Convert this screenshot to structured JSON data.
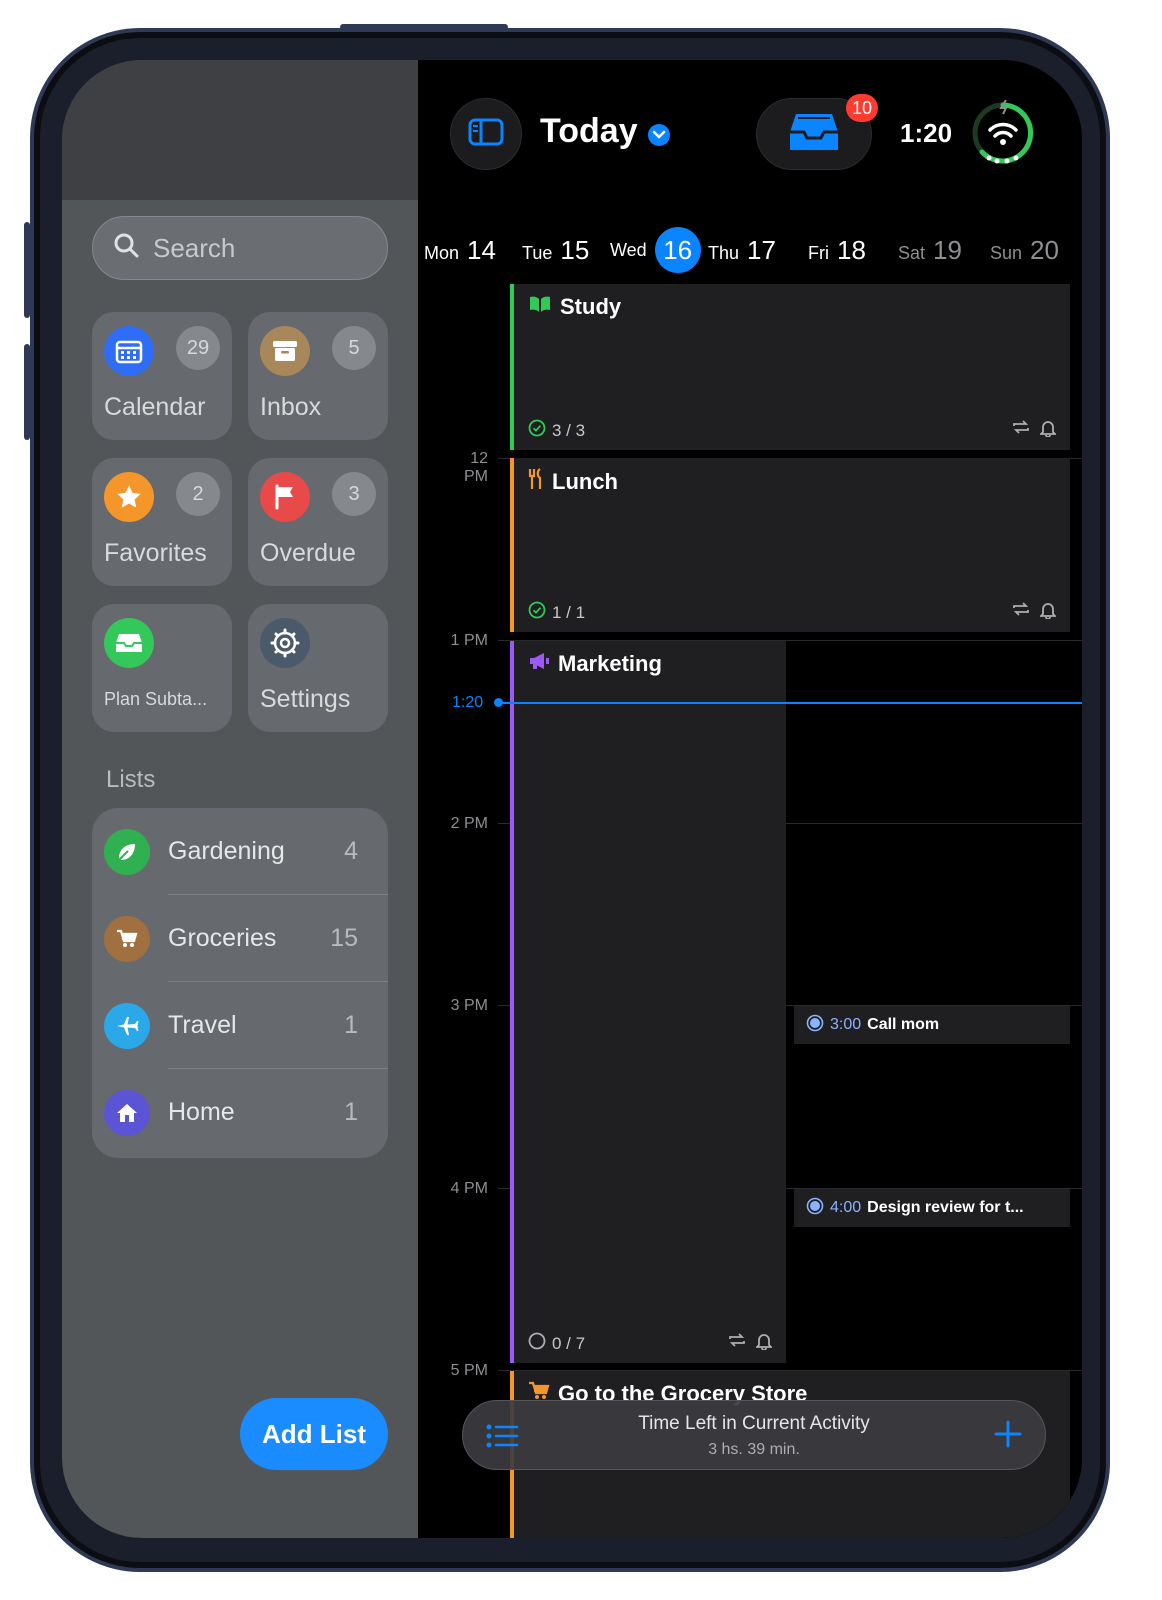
{
  "sidebar": {
    "search_placeholder": "Search",
    "tiles": [
      {
        "label": "Calendar",
        "count": "29",
        "color": "#2f6df6"
      },
      {
        "label": "Inbox",
        "count": "5",
        "color": "#a8875a"
      },
      {
        "label": "Favorites",
        "count": "2",
        "color": "#f5962a"
      },
      {
        "label": "Overdue",
        "count": "3",
        "color": "#e84a4a"
      },
      {
        "label": "Plan Subta...",
        "count": "",
        "color": "#34c759"
      },
      {
        "label": "Settings",
        "count": "",
        "color": "#4a5a6a"
      }
    ],
    "lists_heading": "Lists",
    "lists": [
      {
        "name": "Gardening",
        "count": "4",
        "color": "#30b050"
      },
      {
        "name": "Groceries",
        "count": "15",
        "color": "#a07040"
      },
      {
        "name": "Travel",
        "count": "1",
        "color": "#2aa8e8"
      },
      {
        "name": "Home",
        "count": "1",
        "color": "#5b55d6"
      }
    ],
    "add_list_label": "Add List"
  },
  "header": {
    "title": "Today",
    "inbox_badge": "10",
    "time": "1:20"
  },
  "week": [
    {
      "name": "Mon",
      "date": "14"
    },
    {
      "name": "Tue",
      "date": "15"
    },
    {
      "name": "Wed",
      "date": "16",
      "selected": true
    },
    {
      "name": "Thu",
      "date": "17"
    },
    {
      "name": "Fri",
      "date": "18"
    },
    {
      "name": "Sat",
      "date": "19"
    },
    {
      "name": "Sun",
      "date": "20"
    }
  ],
  "timeline": {
    "hours": [
      "12 PM",
      "1 PM",
      "2 PM",
      "3 PM",
      "4 PM",
      "5 PM"
    ],
    "now_label": "1:20",
    "events": [
      {
        "title": "Study",
        "progress": "3 / 3",
        "color": "#34c759"
      },
      {
        "title": "Lunch",
        "progress": "1 / 1",
        "color": "#f5962a"
      },
      {
        "title": "Marketing",
        "progress": "0 / 7",
        "color": "#9b59f5"
      },
      {
        "title": "Go to the Grocery Store",
        "color": "#f5962a"
      }
    ],
    "small_events": [
      {
        "time": "3:00",
        "title": "Call mom"
      },
      {
        "time": "4:00",
        "title": "Design review for t..."
      }
    ]
  },
  "bottom_bar": {
    "title": "Time Left in Current Activity",
    "subtitle": "3 hs. 39 min."
  }
}
